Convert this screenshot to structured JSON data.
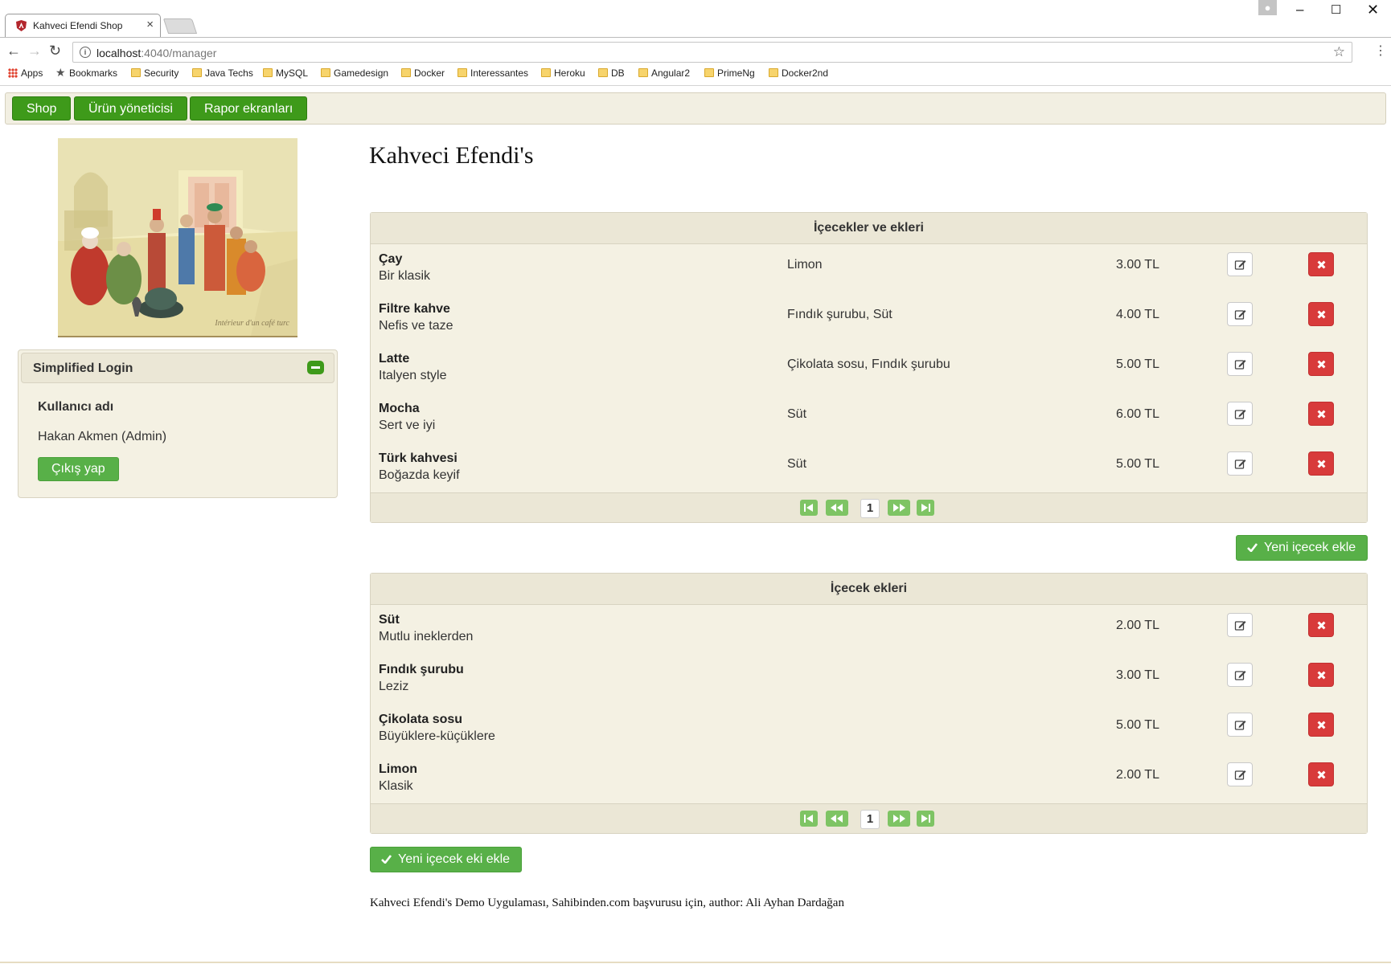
{
  "browser": {
    "tab_title": "Kahveci Efendi Shop",
    "url_host": "localhost",
    "url_rest": ":4040/manager",
    "bookmarks": [
      {
        "label": "Apps",
        "icon": "apps-grid-icon"
      },
      {
        "label": "Bookmarks",
        "icon": "star-icon"
      },
      {
        "label": "Security",
        "icon": "folder-icon"
      },
      {
        "label": "Java Techs",
        "icon": "folder-icon"
      },
      {
        "label": "MySQL",
        "icon": "folder-icon"
      },
      {
        "label": "Gamedesign",
        "icon": "folder-icon"
      },
      {
        "label": "Docker",
        "icon": "folder-icon"
      },
      {
        "label": "Interessantes",
        "icon": "folder-icon"
      },
      {
        "label": "Heroku",
        "icon": "folder-icon"
      },
      {
        "label": "DB",
        "icon": "folder-icon"
      },
      {
        "label": "Angular2",
        "icon": "folder-icon"
      },
      {
        "label": "PrimeNg",
        "icon": "folder-icon"
      },
      {
        "label": "Docker2nd",
        "icon": "folder-icon"
      }
    ]
  },
  "nav": {
    "shop": "Shop",
    "manager": "Ürün yöneticisi",
    "reports": "Rapor ekranları"
  },
  "login": {
    "title": "Simplified Login",
    "username_label": "Kullanıcı adı",
    "username_value": "Hakan Akmen (Admin)",
    "logout": "Çıkış yap"
  },
  "page_title": "Kahveci Efendi's",
  "drinks": {
    "header": "İçecekler ve ekleri",
    "rows": [
      {
        "name": "Çay",
        "desc": "Bir klasik",
        "addons": "Limon",
        "price": "3.00 TL"
      },
      {
        "name": "Filtre kahve",
        "desc": "Nefis ve taze",
        "addons": "Fındık şurubu, Süt",
        "price": "4.00 TL"
      },
      {
        "name": "Latte",
        "desc": "Italyen style",
        "addons": "Çikolata sosu, Fındık şurubu",
        "price": "5.00 TL"
      },
      {
        "name": "Mocha",
        "desc": "Sert ve iyi",
        "addons": "Süt",
        "price": "6.00 TL"
      },
      {
        "name": "Türk kahvesi",
        "desc": "Boğazda keyif",
        "addons": "Süt",
        "price": "5.00 TL"
      }
    ],
    "page": "1",
    "add_button": "Yeni içecek ekle"
  },
  "addons": {
    "header": "İçecek ekleri",
    "rows": [
      {
        "name": "Süt",
        "desc": "Mutlu ineklerden",
        "price": "2.00 TL"
      },
      {
        "name": "Fındık şurubu",
        "desc": "Leziz",
        "price": "3.00 TL"
      },
      {
        "name": "Çikolata sosu",
        "desc": "Büyüklere-küçüklere",
        "price": "5.00 TL"
      },
      {
        "name": "Limon",
        "desc": "Klasik",
        "price": "2.00 TL"
      }
    ],
    "page": "1",
    "add_button": "Yeni içecek eki ekle"
  },
  "picture_signature": "Intérieur d'un café turc",
  "footer": "Kahveci Efendi's Demo Uygulaması, Sahibinden.com başvurusu için, author: Ali Ayhan Dardağan",
  "colors": {
    "nav_green": "#3e9a1a",
    "button_green": "#58b048",
    "delete_red": "#d83b3b",
    "panel_bg": "#f4f1e3",
    "header_bg": "#ebe7d6"
  }
}
